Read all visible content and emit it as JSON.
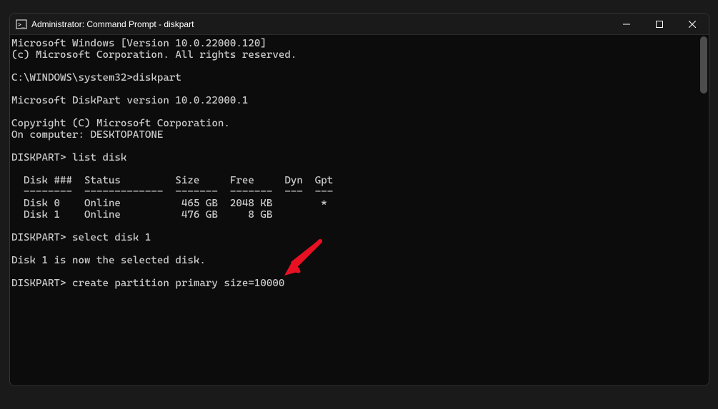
{
  "window": {
    "title": "Administrator: Command Prompt - diskpart"
  },
  "terminal": {
    "lines": {
      "l1": "Microsoft Windows [Version 10.0.22000.120]",
      "l2": "(c) Microsoft Corporation. All rights reserved.",
      "l3": "",
      "l4": "C:\\WINDOWS\\system32>diskpart",
      "l5": "",
      "l6": "Microsoft DiskPart version 10.0.22000.1",
      "l7": "",
      "l8": "Copyright (C) Microsoft Corporation.",
      "l9": "On computer: DESKTOPATONE",
      "l10": "",
      "l11": "DISKPART> list disk",
      "l12": "",
      "l13": "  Disk ###  Status         Size     Free     Dyn  Gpt",
      "l14": "  --------  -------------  -------  -------  ---  ---",
      "l15": "  Disk 0    Online          465 GB  2048 KB        *",
      "l16": "  Disk 1    Online          476 GB     8 GB",
      "l17": "",
      "l18": "DISKPART> select disk 1",
      "l19": "",
      "l20": "Disk 1 is now the selected disk.",
      "l21": "",
      "l22": "DISKPART> create partition primary size=10000"
    }
  }
}
